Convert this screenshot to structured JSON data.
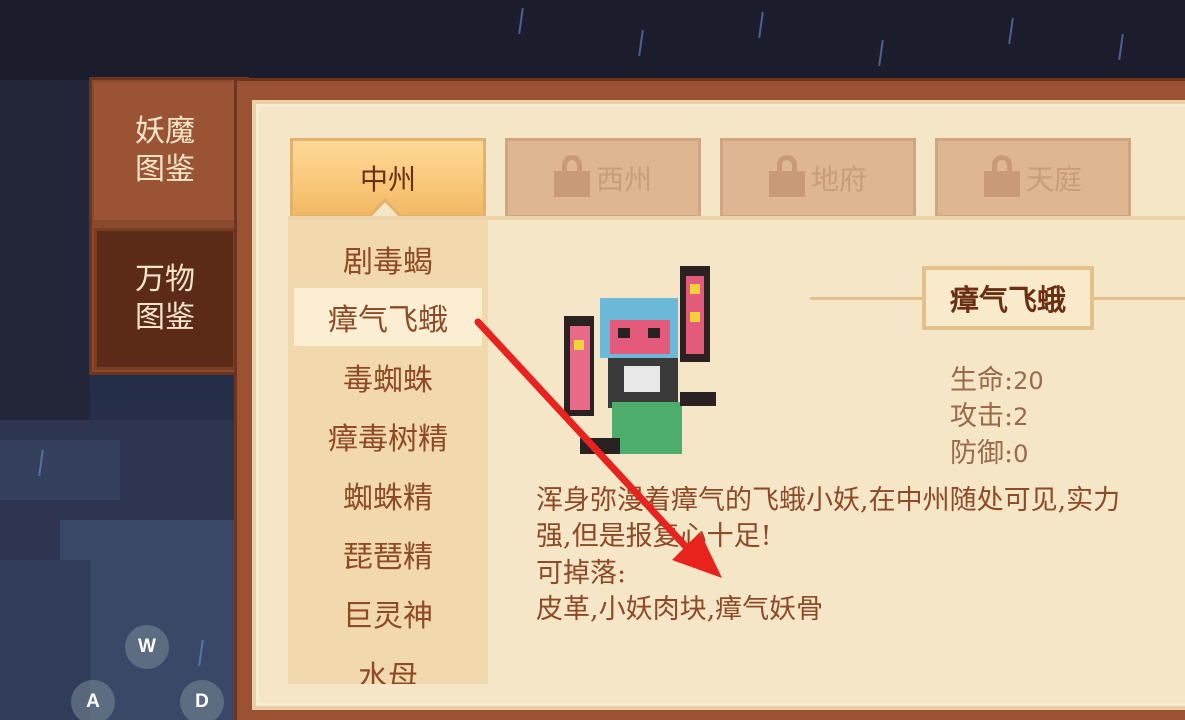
{
  "side_menu": {
    "items": [
      {
        "label": "妖魔\n图鉴",
        "active": true
      },
      {
        "label": "万物\n图鉴",
        "active": false
      }
    ]
  },
  "region_tabs": [
    {
      "label": "中州",
      "locked": false,
      "active": true
    },
    {
      "label": "西州",
      "locked": true,
      "active": false
    },
    {
      "label": "地府",
      "locked": true,
      "active": false
    },
    {
      "label": "天庭",
      "locked": true,
      "active": false
    }
  ],
  "monster_list": [
    "剧毒蝎",
    "瘴气飞蛾",
    "毒蜘蛛",
    "瘴毒树精",
    "蜘蛛精",
    "琵琶精",
    "巨灵神",
    "水母"
  ],
  "selected_monster": {
    "name": "瘴气飞蛾",
    "stats": [
      {
        "label": "生命:",
        "value": "20"
      },
      {
        "label": "攻击:",
        "value": "2"
      },
      {
        "label": "防御:",
        "value": "0"
      }
    ],
    "description_lines": [
      "浑身弥漫着瘴气的飞蛾小妖,在中州随处可见,实力",
      "强,但是报复心十足!",
      "可掉落:",
      "皮革,小妖肉块,瘴气妖骨"
    ]
  },
  "controls": {
    "keys": [
      "W",
      "A",
      "D"
    ]
  },
  "colors": {
    "panel_bg": "#f6e6c8",
    "frame": "#9b5232",
    "text_brown": "#8e4a26",
    "active_tab": "#f8c777",
    "annotation_arrow": "#e8231e"
  }
}
